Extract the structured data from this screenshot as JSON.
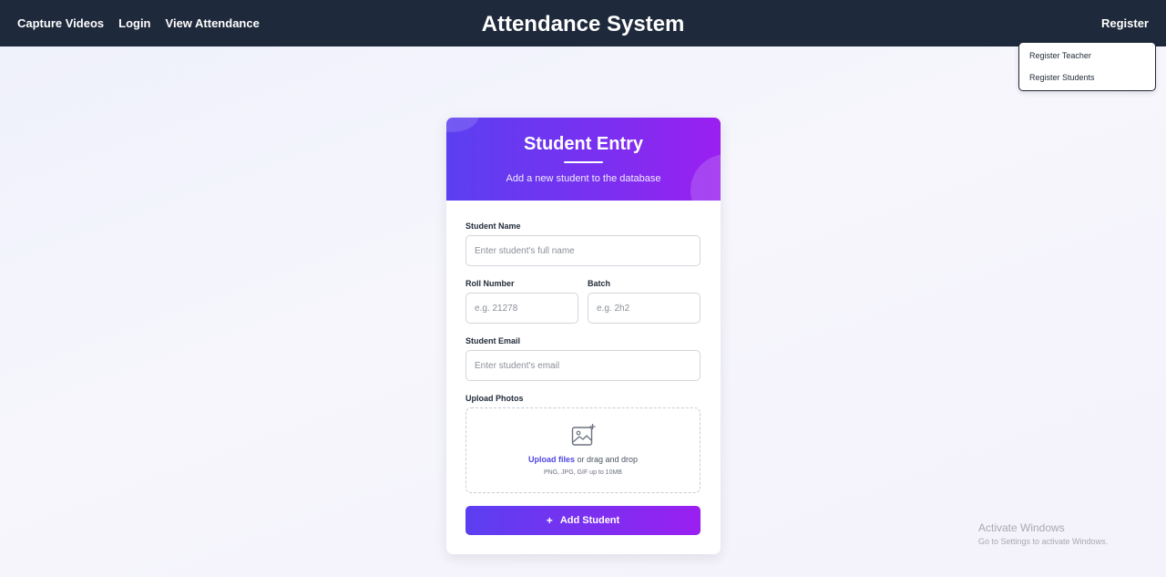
{
  "nav": {
    "links": [
      "Capture Videos",
      "Login",
      "View Attendance"
    ],
    "brand": "Attendance System",
    "register_label": "Register"
  },
  "dropdown": {
    "items": [
      "Register Teacher",
      "Register Students"
    ]
  },
  "form": {
    "title": "Student Entry",
    "subtitle": "Add a new student to the database",
    "name_label": "Student Name",
    "name_placeholder": "Enter student's full name",
    "roll_label": "Roll Number",
    "roll_placeholder": "e.g. 21278",
    "batch_label": "Batch",
    "batch_placeholder": "e.g. 2h2",
    "email_label": "Student Email",
    "email_placeholder": "Enter student's email",
    "photos_label": "Upload Photos",
    "upload_link": "Upload files",
    "upload_rest": " or drag and drop",
    "upload_hint": "PNG, JPG, GIF up to 10MB",
    "submit_icon": "+",
    "submit_label": "Add Student"
  },
  "watermark": {
    "title": "Activate Windows",
    "subtitle": "Go to Settings to activate Windows."
  },
  "colors": {
    "navbar": "#1e293b",
    "accent_start": "#5b3ff0",
    "accent_end": "#9a1ff0",
    "link": "#4f46e5"
  },
  "icons": [
    "image-upload-icon",
    "plus-icon"
  ]
}
